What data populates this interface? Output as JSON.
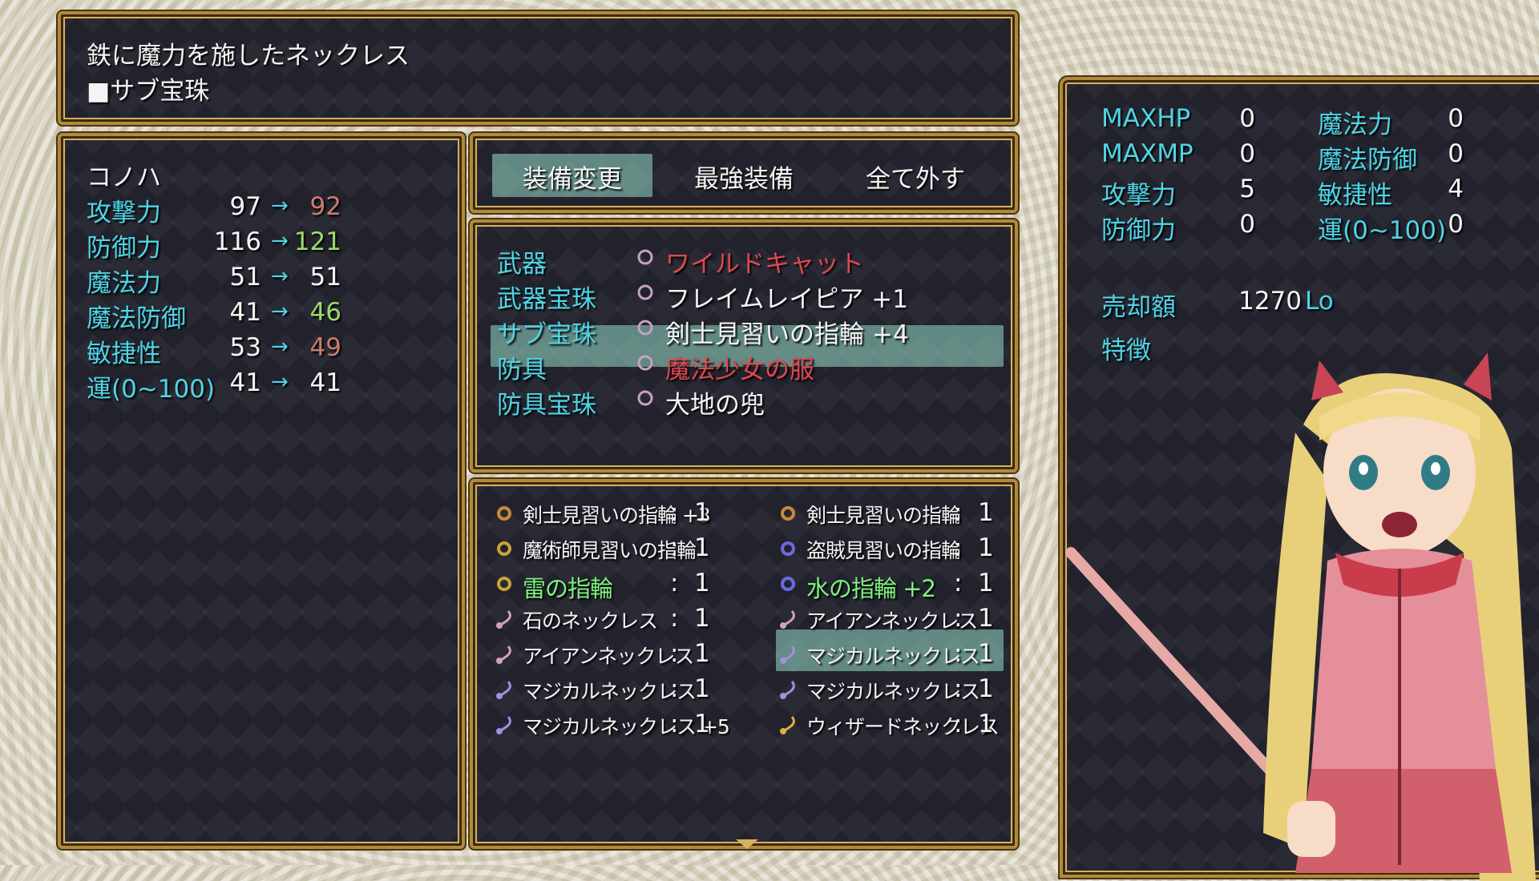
{
  "help": {
    "line1": "鉄に魔力を施したネックレス",
    "line2": "■サブ宝珠"
  },
  "status": {
    "name": "コノハ",
    "rows": [
      {
        "label": "攻撃力",
        "cur": "97",
        "new": "92",
        "trend": "down"
      },
      {
        "label": "防御力",
        "cur": "116",
        "new": "121",
        "trend": "up"
      },
      {
        "label": "魔法力",
        "cur": "51",
        "new": "51",
        "trend": "same"
      },
      {
        "label": "魔法防御",
        "cur": "41",
        "new": "46",
        "trend": "up"
      },
      {
        "label": "敏捷性",
        "cur": "53",
        "new": "49",
        "trend": "down"
      },
      {
        "label": "運(0~100)",
        "cur": "41",
        "new": "41",
        "trend": "same"
      }
    ],
    "arrow": "→"
  },
  "commands": [
    "装備変更",
    "最強装備",
    "全て外す"
  ],
  "slots": [
    {
      "label": "武器",
      "item": "ワイルドキャット",
      "item_color": "#e0484f",
      "icon": "sword-icon"
    },
    {
      "label": "武器宝珠",
      "item": "フレイムレイピア +1",
      "item_color": "#f4f4f4",
      "icon": "rapier-icon"
    },
    {
      "label": "サブ宝珠",
      "item": "剣士見習いの指輪 +4",
      "item_color": "#f4f4f4",
      "icon": "ring-icon"
    },
    {
      "label": "防具",
      "item": "魔法少女の服",
      "item_color": "#e0484f",
      "icon": "armor-icon"
    },
    {
      "label": "防具宝珠",
      "item": "大地の兜",
      "item_color": "#f4f4f4",
      "icon": "helmet-icon"
    }
  ],
  "inventory": [
    {
      "name": "剣士見習いの指輪 +3",
      "count": "1",
      "icon": "ring-icon",
      "icon_color": "#c98a3a",
      "green": false
    },
    {
      "name": "剣士見習いの指輪",
      "count": "1",
      "icon": "ring-icon",
      "icon_color": "#c98a3a",
      "green": false
    },
    {
      "name": "魔術師見習いの指輪",
      "count": "1",
      "icon": "ring-icon",
      "icon_color": "#c9a23a",
      "green": false
    },
    {
      "name": "盗賊見習いの指輪",
      "count": "1",
      "icon": "ring-icon",
      "icon_color": "#6a6ae0",
      "green": false
    },
    {
      "name": "雷の指輪",
      "count": "1",
      "icon": "ring-icon",
      "icon_color": "#c9a23a",
      "green": true
    },
    {
      "name": "水の指輪 +2",
      "count": "1",
      "icon": "ring-icon",
      "icon_color": "#6a6ae0",
      "green": true
    },
    {
      "name": "石のネックレス",
      "count": "1",
      "icon": "necklace-icon",
      "icon_color": "#d0a0c0",
      "green": false
    },
    {
      "name": "アイアンネックレス",
      "count": "1",
      "icon": "necklace-icon",
      "icon_color": "#d0a0c0",
      "green": false
    },
    {
      "name": "アイアンネックレス",
      "count": "1",
      "icon": "necklace-icon",
      "icon_color": "#d0a0c0",
      "green": false
    },
    {
      "name": "マジカルネックレス",
      "count": "1",
      "icon": "necklace-icon",
      "icon_color": "#a090e0",
      "green": false
    },
    {
      "name": "マジカルネックレス",
      "count": "1",
      "icon": "necklace-icon",
      "icon_color": "#a090e0",
      "green": false
    },
    {
      "name": "マジカルネックレス",
      "count": "1",
      "icon": "necklace-icon",
      "icon_color": "#a090e0",
      "green": false
    },
    {
      "name": "マジカルネックレス +5",
      "count": "1",
      "icon": "necklace-icon",
      "icon_color": "#a090e0",
      "green": false
    },
    {
      "name": "ウィザードネックレス",
      "count": "1",
      "icon": "necklace-icon",
      "icon_color": "#e0b040",
      "green": false
    }
  ],
  "selected_inventory_index": 7,
  "colon": ":",
  "item_info": {
    "stats": [
      {
        "label": "MAXHP",
        "value": "0"
      },
      {
        "label": "魔法力",
        "value": "0"
      },
      {
        "label": "MAXMP",
        "value": "0"
      },
      {
        "label": "魔法防御",
        "value": "0"
      },
      {
        "label": "攻撃力",
        "value": "5"
      },
      {
        "label": "敏捷性",
        "value": "4"
      },
      {
        "label": "防御力",
        "value": "0"
      },
      {
        "label": "運(0~100)",
        "value": "0"
      }
    ],
    "price_label": "売却額",
    "price_value": "1270",
    "currency": "Lo",
    "traits_label": "特徴"
  },
  "colors": {
    "frame": "#b08a3c",
    "accent": "#4fd4e6",
    "highlight": "#96dcc8",
    "down": "#c77d6d",
    "up": "#9bd96a"
  }
}
